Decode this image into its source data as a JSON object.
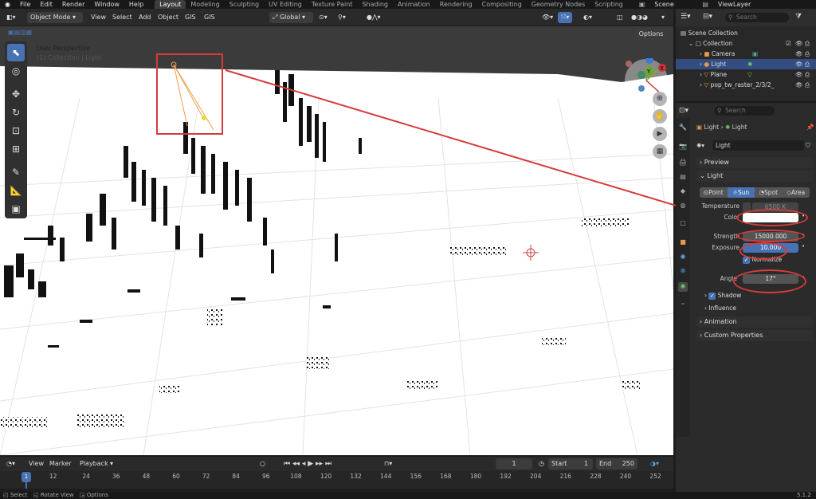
{
  "menubar": {
    "items": [
      "File",
      "Edit",
      "Render",
      "Window",
      "Help"
    ],
    "workspaces": [
      "Layout",
      "Modeling",
      "Sculpting",
      "UV Editing",
      "Texture Paint",
      "Shading",
      "Animation",
      "Rendering",
      "Compositing",
      "Geometry Nodes",
      "Scripting"
    ],
    "active_workspace": "Layout",
    "scene": "Scene",
    "view_layer": "ViewLayer"
  },
  "viewport_header": {
    "mode": "Object Mode",
    "menus": [
      "View",
      "Select",
      "Add",
      "Object",
      "GIS",
      "GIS"
    ],
    "orientation": "Global",
    "options": "Options"
  },
  "viewport": {
    "perspective": "User Perspective",
    "collection_info": "(1) Collection | Light",
    "gizmo_axes": [
      "X",
      "Y",
      "Z"
    ]
  },
  "outliner": {
    "search_placeholder": "Search",
    "root": "Scene Collection",
    "collection": "Collection",
    "items": [
      {
        "name": "Camera",
        "icon": "camera-icon",
        "selected": false
      },
      {
        "name": "Light",
        "icon": "light-icon",
        "selected": true
      },
      {
        "name": "Plane",
        "icon": "mesh-icon",
        "selected": false
      },
      {
        "name": "pop_tw_raster_2/3/2_",
        "icon": "mesh-icon",
        "selected": false
      }
    ]
  },
  "properties": {
    "search_placeholder": "Search",
    "breadcrumb": [
      "Light",
      "Light"
    ],
    "datablock": "Light",
    "panels": {
      "preview": "Preview",
      "light": "Light",
      "shadow": "Shadow",
      "influence": "Influence",
      "animation": "Animation",
      "custom": "Custom Properties"
    },
    "light_types": [
      "Point",
      "Sun",
      "Spot",
      "Area"
    ],
    "active_type": "Sun",
    "temperature_label": "Temperature",
    "temperature_value": "6500 K",
    "color_label": "Color",
    "color_value": "#ffffff",
    "strength_label": "Strength",
    "strength_value": "15000.000",
    "exposure_label": "Exposure",
    "exposure_value": "10.000",
    "normalize_label": "Normalize",
    "angle_label": "Angle",
    "angle_value": "17°"
  },
  "timeline": {
    "menus": [
      "View",
      "Marker",
      "Playback"
    ],
    "current_frame": "1",
    "start_label": "Start",
    "start": "1",
    "end_label": "End",
    "end": "250",
    "ticks": [
      "1",
      "12",
      "24",
      "36",
      "48",
      "60",
      "72",
      "84",
      "96",
      "108",
      "120",
      "132",
      "144",
      "156",
      "168",
      "180",
      "192",
      "204",
      "216",
      "228",
      "240",
      "252"
    ]
  },
  "statusbar": {
    "items": [
      "Select",
      "Rotate View",
      "Options"
    ],
    "version": "5.1.2"
  },
  "colors": {
    "accent": "#4772b3",
    "annotation": "#d63b3b",
    "selected_row": "#334d80"
  }
}
